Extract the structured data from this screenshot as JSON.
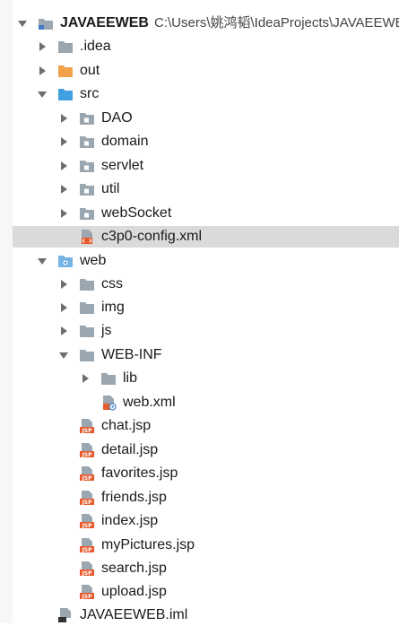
{
  "colors": {
    "folder": "#9aa7b0",
    "folder_dark": "#7f8b94",
    "excluded_folder": "#f2a24b",
    "source_folder": "#40a0e0",
    "web_folder": "#77b4e6",
    "selection": "#dadada",
    "jsp_badge": "#e85a2b"
  },
  "tree": {
    "project": {
      "name": "JAVAEEWEB",
      "path": "C:\\Users\\姚鸿韬\\IdeaProjects\\JAVAEEWEB"
    },
    "idea_label": ".idea",
    "out_label": "out",
    "src_label": "src",
    "dao_label": "DAO",
    "domain_label": "domain",
    "servlet_label": "servlet",
    "util_label": "util",
    "websocket_label": "webSocket",
    "c3p0_label": "c3p0-config.xml",
    "web_label": "web",
    "css_label": "css",
    "img_label": "img",
    "js_label": "js",
    "webinf_label": "WEB-INF",
    "lib_label": "lib",
    "webxml_label": "web.xml",
    "jsp_files": [
      "chat.jsp",
      "detail.jsp",
      "favorites.jsp",
      "friends.jsp",
      "index.jsp",
      "myPictures.jsp",
      "search.jsp",
      "upload.jsp"
    ],
    "iml_label": "JAVAEEWEB.iml"
  },
  "icons": {
    "collapsed_arrow": "chevron-right-icon",
    "expanded_arrow": "chevron-down-icon",
    "folder": "folder-icon",
    "package": "package-icon",
    "xml": "xml-file-icon",
    "jsp": "jsp-file-icon",
    "iml": "module-file-icon"
  }
}
